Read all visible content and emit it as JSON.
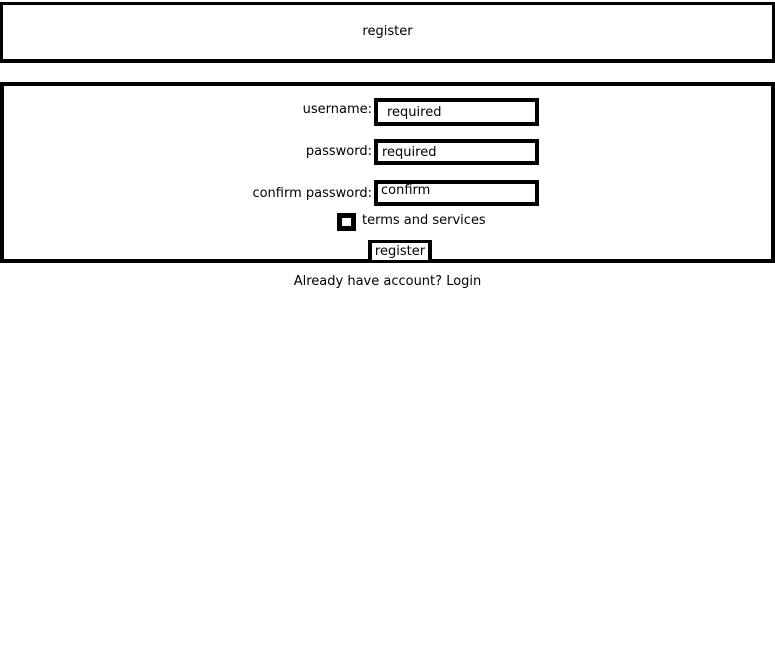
{
  "header": {
    "title": "register"
  },
  "form": {
    "username": {
      "label": "username:",
      "placeholder": "required"
    },
    "password": {
      "label": "password:",
      "placeholder": "required"
    },
    "confirm_password": {
      "label": "confirm password:",
      "placeholder": "confirm"
    },
    "terms": {
      "label": "terms and services",
      "checked": false
    },
    "submit_label": "register"
  },
  "footer": {
    "prompt": "Already have account?",
    "login_label": "Login"
  }
}
